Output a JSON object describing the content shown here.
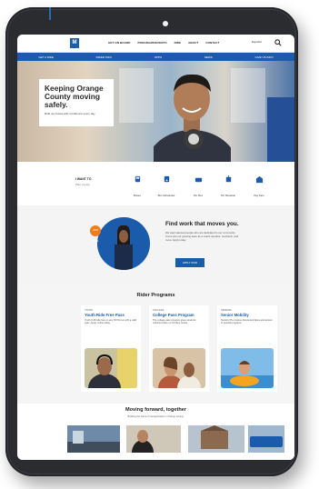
{
  "nav": {
    "logo_text": "M",
    "links": [
      "GET ON BOARD",
      "PROGRAMS/EVENTS",
      "RIDE",
      "ABOUT",
      "CONTACT"
    ],
    "language": "Español"
  },
  "quickbar": {
    "items": [
      "GET A RIDE",
      "RIDER INFO",
      "OPPS",
      "NEWS",
      "GIVE US INFO"
    ]
  },
  "hero": {
    "title": "Keeping Orange County moving safely.",
    "subtitle": "Ride our buses with confidence every day."
  },
  "iwant": {
    "label": "I WANT TO",
    "sub": "Plan my trip",
    "items": [
      "Buses",
      "Bus Schedules",
      "OC Flex",
      "OC Streetcar",
      "Pay Fare"
    ]
  },
  "findwork": {
    "badge": "JOIN OCTA",
    "title": "Find work that moves you.",
    "text": "We want talented people who are dedicated to our community. Come join our growing team as a coach operator, mechanic, and more. Apply today.",
    "button": "APPLY NOW"
  },
  "programs": {
    "title": "Rider Programs",
    "cards": [
      {
        "kicker": "YOUTH",
        "name": "Youth Ride Free Pass",
        "desc": "Youth 6-18 ride free on any OCTA bus with a valid pass. Apply online today."
      },
      {
        "kicker": "COLLEGE",
        "name": "College Pass Program",
        "desc": "The college pass program gives students unlimited rides on OC Bus routes."
      },
      {
        "kicker": "SENIORS",
        "name": "Senior Mobility",
        "desc": "Seniors 65+ receive discounted fares and access to special programs."
      }
    ]
  },
  "forward": {
    "title": "Moving forward, together",
    "sub": "Building the future of transportation in Orange County."
  },
  "colors": {
    "brand_blue": "#1a5cab",
    "accent_orange": "#f07c1c",
    "device_frame": "#3b3e44"
  }
}
